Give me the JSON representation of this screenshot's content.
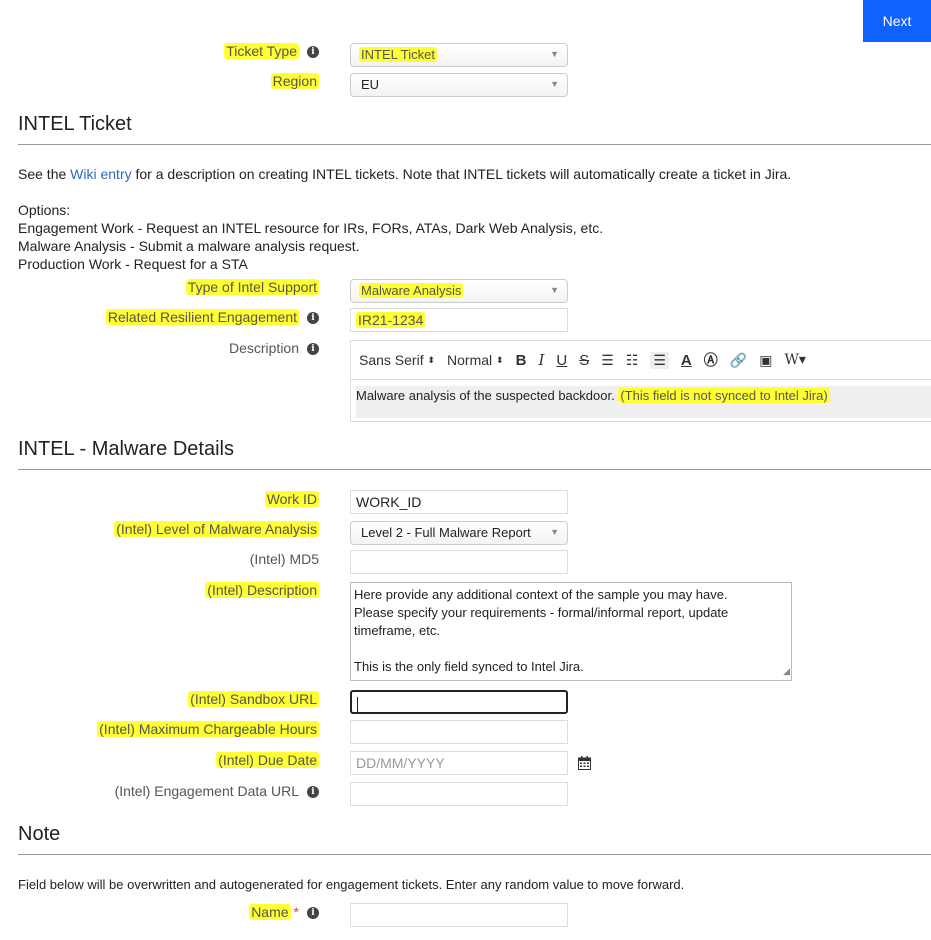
{
  "header": {
    "next_label": "Next"
  },
  "ticket_type": {
    "label": "Ticket Type",
    "value": "INTEL Ticket"
  },
  "region": {
    "label": "Region",
    "value": "EU"
  },
  "intel_ticket": {
    "title": "INTEL Ticket",
    "desc_prefix": "See the ",
    "desc_link": "Wiki entry",
    "desc_suffix": " for a description on creating INTEL tickets. Note that INTEL tickets will automatically create a ticket in Jira.",
    "options_heading": "Options:",
    "options": [
      "Engagement Work - Request an INTEL resource for IRs, FORs, ATAs, Dark Web Analysis, etc.",
      "Malware Analysis - Submit a malware analysis request.",
      "Production Work - Request for a STA"
    ],
    "type_of_support": {
      "label": "Type of Intel Support",
      "value": "Malware Analysis"
    },
    "related_engagement": {
      "label": "Related Resilient Engagement",
      "value": "IR21-1234"
    },
    "description": {
      "label": "Description",
      "toolbar": {
        "font": "Sans Serif",
        "size": "Normal"
      },
      "text_plain": "Malware analysis of the suspected backdoor. ",
      "text_highlight": "(This field is not synced to Intel Jira)"
    }
  },
  "malware_details": {
    "title": "INTEL - Malware Details",
    "work_id": {
      "label": "Work ID",
      "value": "WORK_ID"
    },
    "level": {
      "label": "(Intel) Level of Malware Analysis",
      "value": "Level 2 - Full Malware Report"
    },
    "md5": {
      "label": "(Intel) MD5",
      "value": ""
    },
    "intel_description": {
      "label": "(Intel) Description",
      "lines": [
        "Here provide any additional context of the sample you may have.",
        "Please specify your requirements - formal/informal report, update",
        "timeframe, etc.",
        "",
        "This is the only field synced to Intel Jira."
      ]
    },
    "sandbox_url": {
      "label": "(Intel) Sandbox URL",
      "value": ""
    },
    "max_hours": {
      "label": "(Intel) Maximum Chargeable Hours",
      "value": ""
    },
    "due_date": {
      "label": "(Intel) Due Date",
      "placeholder": "DD/MM/YYYY"
    },
    "engagement_data_url": {
      "label": "(Intel) Engagement Data URL",
      "value": ""
    }
  },
  "note": {
    "title": "Note",
    "text": "Field below will be overwritten and autogenerated for engagement tickets. Enter any random value to move forward.",
    "name": {
      "label": "Name",
      "required_mark": "*",
      "value": ""
    }
  },
  "colors": {
    "highlight": "#ffff33",
    "primary": "#0f62fe",
    "link": "#2a6ebb"
  }
}
